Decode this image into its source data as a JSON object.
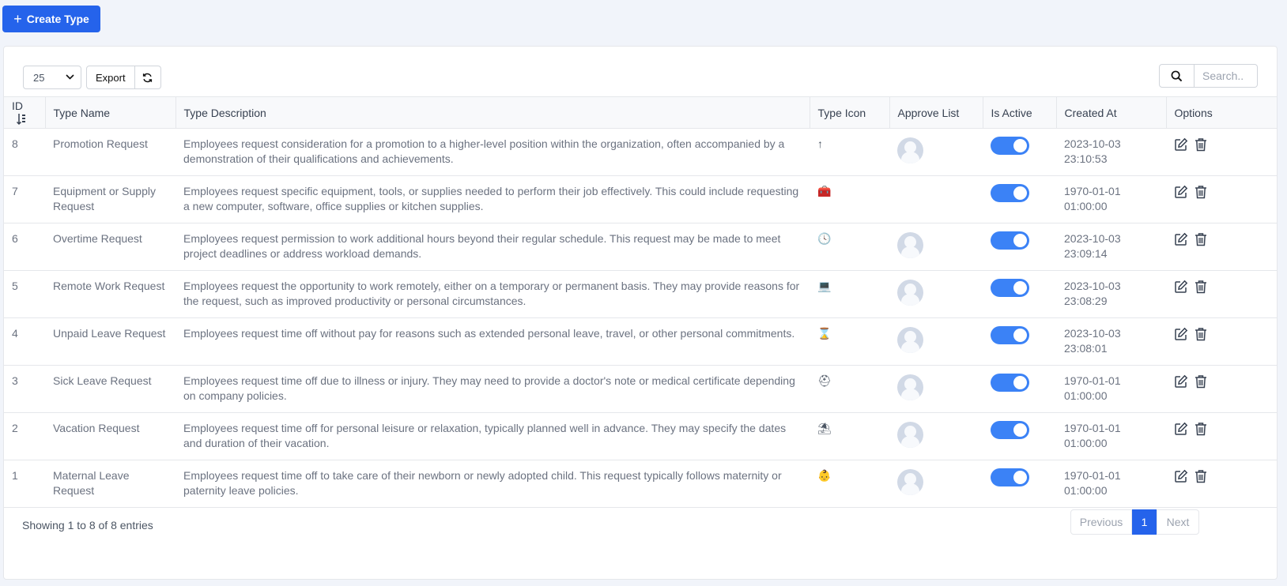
{
  "header": {
    "create_label": "Create Type"
  },
  "toolbar": {
    "page_size": "25",
    "export_label": "Export",
    "search_placeholder": "Search.."
  },
  "table": {
    "columns": [
      "ID",
      "Type Name",
      "Type Description",
      "Type Icon",
      "Approve List",
      "Is Active",
      "Created At",
      "Options"
    ],
    "rows": [
      {
        "id": "8",
        "name": "Promotion Request",
        "desc": "Employees request consideration for a promotion to a higher-level position within the organization, often accompanied by a demonstration of their qualifications and achievements.",
        "icon": "arrow-up-icon",
        "glyph": "↑",
        "approver": true,
        "active": true,
        "created_date": "2023-10-03",
        "created_time": "23:10:53"
      },
      {
        "id": "7",
        "name": "Equipment or Supply Request",
        "desc": "Employees request specific equipment, tools, or supplies needed to perform their job effectively. This could include requesting a new computer, software, office supplies or kitchen supplies.",
        "icon": "toolbox-icon",
        "glyph": "🧰",
        "approver": false,
        "active": true,
        "created_date": "1970-01-01",
        "created_time": "01:00:00"
      },
      {
        "id": "6",
        "name": "Overtime Request",
        "desc": "Employees request permission to work additional hours beyond their regular schedule. This request may be made to meet project deadlines or address workload demands.",
        "icon": "clock-icon",
        "glyph": "🕓",
        "approver": true,
        "active": true,
        "created_date": "2023-10-03",
        "created_time": "23:09:14"
      },
      {
        "id": "5",
        "name": "Remote Work Request",
        "desc": "Employees request the opportunity to work remotely, either on a temporary or permanent basis. They may provide reasons for the request, such as improved productivity or personal circumstances.",
        "icon": "laptop-icon",
        "glyph": "💻",
        "approver": true,
        "active": true,
        "created_date": "2023-10-03",
        "created_time": "23:08:29"
      },
      {
        "id": "4",
        "name": "Unpaid Leave Request",
        "desc": "Employees request time off without pay for reasons such as extended personal leave, travel, or other personal commitments.",
        "icon": "hourglass-icon",
        "glyph": "⌛",
        "approver": true,
        "active": true,
        "created_date": "2023-10-03",
        "created_time": "23:08:01"
      },
      {
        "id": "3",
        "name": "Sick Leave Request",
        "desc": "Employees request time off due to illness or injury. They may need to provide a doctor's note or medical certificate depending on company policies.",
        "icon": "medical-kit-icon",
        "glyph": "⛑",
        "approver": true,
        "active": true,
        "created_date": "1970-01-01",
        "created_time": "01:00:00"
      },
      {
        "id": "2",
        "name": "Vacation Request",
        "desc": "Employees request time off for personal leisure or relaxation, typically planned well in advance. They may specify the dates and duration of their vacation.",
        "icon": "umbrella-beach-icon",
        "glyph": "⛱",
        "approver": true,
        "active": true,
        "created_date": "1970-01-01",
        "created_time": "01:00:00"
      },
      {
        "id": "1",
        "name": "Maternal Leave Request",
        "desc": "Employees request time off to take care of their newborn or newly adopted child. This request typically follows maternity or paternity leave policies.",
        "icon": "baby-icon",
        "glyph": "👶",
        "approver": true,
        "active": true,
        "created_date": "1970-01-01",
        "created_time": "01:00:00"
      }
    ]
  },
  "footer": {
    "info": "Showing 1 to 8 of 8 entries",
    "prev_label": "Previous",
    "current_page": "1",
    "next_label": "Next"
  },
  "colors": {
    "primary": "#2563eb",
    "toggle": "#3b82f6"
  }
}
